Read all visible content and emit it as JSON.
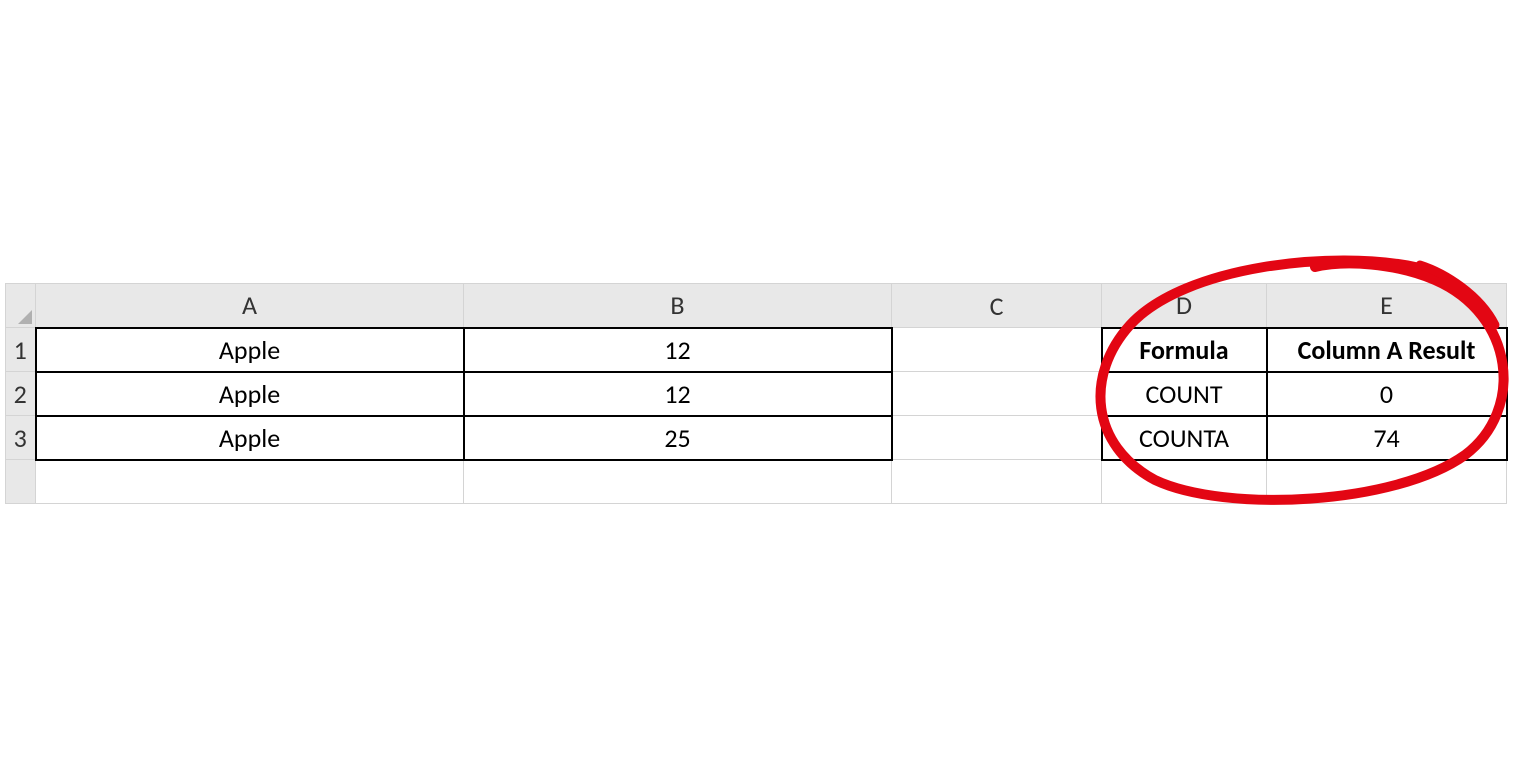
{
  "columns": {
    "A": "A",
    "B": "B",
    "C": "C",
    "D": "D",
    "E": "E"
  },
  "rows": {
    "r1": "1",
    "r2": "2",
    "r3": "3"
  },
  "cells": {
    "A1": "Apple",
    "A2": "Apple",
    "A3": "Apple",
    "B1": "12",
    "B2": "12",
    "B3": "25",
    "D1": "Formula",
    "D2": "COUNT",
    "D3": "COUNTA",
    "E1": "Column A Result",
    "E2": "0",
    "E3": "74"
  }
}
